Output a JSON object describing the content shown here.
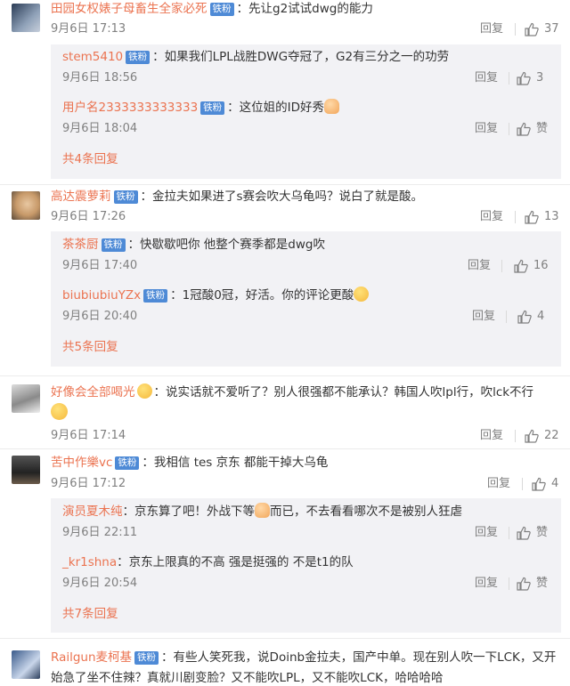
{
  "comments": [
    {
      "user": "田园女权婊子母畜生全家必死",
      "badge": "铁粉",
      "text": "：先让g2试试dwg的能力",
      "time": "9月6日 17:13",
      "reply_label": "回复",
      "likes": "37",
      "replies": [
        {
          "user": "stem5410",
          "badge": "铁粉",
          "text": "：如果我们LPL战胜DWG夺冠了，G2有三分之一的功劳",
          "time": "9月6日 18:56",
          "reply_label": "回复",
          "likes": "3"
        },
        {
          "user": "用户名2333333333333",
          "badge": "铁粉",
          "text": "：这位姐的ID好秀",
          "time": "9月6日 18:04",
          "reply_label": "回复",
          "likes": "赞"
        }
      ],
      "more": "共4条回复"
    },
    {
      "user": "高达震萝莉",
      "badge": "铁粉",
      "text": "：金拉夫如果进了s赛会吹大乌龟吗？说白了就是酸。",
      "time": "9月6日 17:26",
      "reply_label": "回复",
      "likes": "13",
      "replies": [
        {
          "user": "茶茶厨",
          "badge": "铁粉",
          "text": "：快歇歇吧你 他整个赛季都是dwg吹",
          "time": "9月6日 17:40",
          "reply_label": "回复",
          "likes": "16"
        },
        {
          "user": "biubiubiuYZx",
          "badge": "铁粉",
          "text": "：1冠酸0冠，好活。你的评论更酸",
          "time": "9月6日 20:40",
          "reply_label": "回复",
          "likes": "4"
        }
      ],
      "more": "共5条回复"
    },
    {
      "user": "好像会全部喝光",
      "badge": "",
      "text": "：说实话就不爱听了？别人很强都不能承认？韩国人吹lpl行，吹lck不行",
      "time": "9月6日 17:14",
      "reply_label": "回复",
      "likes": "22",
      "replies": [],
      "more": ""
    },
    {
      "user": "苦中作樂vc",
      "badge": "铁粉",
      "text": "：我相信 tes 京东 都能干掉大乌龟",
      "time": "9月6日 17:12",
      "reply_label": "回复",
      "likes": "4",
      "replies": [
        {
          "user": "演员夏木纯",
          "badge": "",
          "text": "：京东算了吧！外战下等",
          "text2": "而已，不去看看哪次不是被别人狂虐",
          "time": "9月6日 22:11",
          "reply_label": "回复",
          "likes": "赞"
        },
        {
          "user": "_kr1shna",
          "badge": "",
          "text": "：京东上限真的不高 强是挺强的 不是t1的队",
          "time": "9月6日 20:54",
          "reply_label": "回复",
          "likes": "赞"
        }
      ],
      "more": "共7条回复"
    },
    {
      "user": "Railgun麦柯基",
      "badge": "铁粉",
      "text": "：有些人笑死我，说Doinb金拉夫，国产中单。现在别人吹一下LCK，又开始急了坐不住辣？真就川剧变脸？又不能吹LPL，又不能吹LCK，哈哈哈哈",
      "time": "",
      "reply_label": "",
      "likes": "",
      "replies": [],
      "more": ""
    }
  ]
}
